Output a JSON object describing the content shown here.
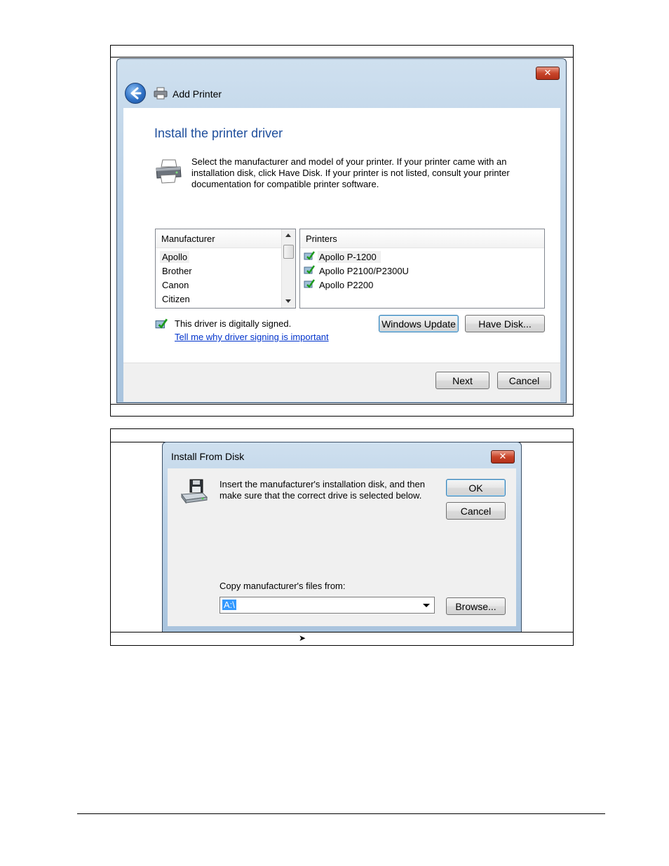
{
  "add_printer": {
    "title": "Add Printer",
    "heading": "Install the printer driver",
    "description": "Select the manufacturer and model of your printer. If your printer came with an installation disk, click Have Disk. If your printer is not listed, consult your printer documentation for compatible printer software.",
    "manufacturer_header": "Manufacturer",
    "manufacturers": [
      "Apollo",
      "Brother",
      "Canon",
      "Citizen"
    ],
    "printers_header": "Printers",
    "printers": [
      "Apollo P-1200",
      "Apollo P2100/P2300U",
      "Apollo P2200"
    ],
    "signed_text": "This driver is digitally signed.",
    "signing_link": "Tell me why driver signing is important",
    "windows_update_label": "Windows Update",
    "have_disk_label": "Have Disk...",
    "next_label": "Next",
    "cancel_label": "Cancel",
    "close_glyph": "✕"
  },
  "install_from_disk": {
    "title": "Install From Disk",
    "message": "Insert the manufacturer's installation disk, and then make sure that the correct drive is selected below.",
    "ok_label": "OK",
    "cancel_label": "Cancel",
    "copy_label": "Copy manufacturer's files from:",
    "path_value": "A:\\",
    "browse_label": "Browse...",
    "close_glyph": "✕"
  },
  "caption_glyph": "➤",
  "colors": {
    "heading_blue": "#1e4e9c",
    "link_blue": "#0033cc",
    "selection_blue": "#3399ff"
  }
}
